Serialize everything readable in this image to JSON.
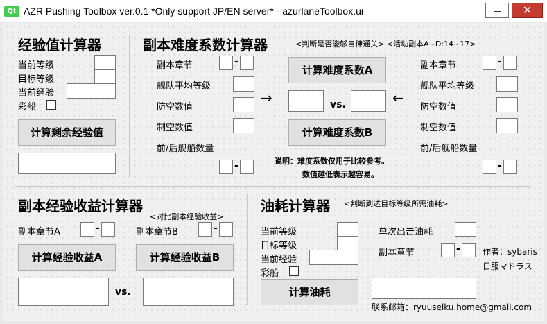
{
  "window": {
    "title": "AZR Pushing Toolbox ver.0.1 *Only support JP/EN server*  - azurlaneToolbox.ui",
    "logo": "Qt",
    "close_symbol": "✕"
  },
  "exp_calc": {
    "title": "经验值计算器",
    "current_level": "当前等级",
    "target_level": "目标等级",
    "current_exp": "当前经验",
    "rainbow": "彩船",
    "button": "计算剩余经验值"
  },
  "difficulty": {
    "title": "副本难度系数计算器",
    "note": "<判断是否能够自律通关> <活动副本A~D:14~17>",
    "left": {
      "chapter": "副本章节",
      "avg_level": "舰队平均等级",
      "aa": "防空数值",
      "air": "制空数值",
      "ships": "前/后舰船数量"
    },
    "right": {
      "chapter": "副本章节",
      "avg_level": "舰队平均等级",
      "aa": "防空数值",
      "air": "制空数值",
      "ships": "前/后舰船数量"
    },
    "button_a": "计算难度系数A",
    "button_b": "计算难度系数B",
    "vs": "vs.",
    "arrow_right": "→",
    "arrow_left": "←",
    "explain_1": "说明：难度系数仅用于比较参考。",
    "explain_2": "数值越低表示越容易。",
    "dash": "-"
  },
  "yield": {
    "title": "副本经验收益计算器",
    "note": "<对比副本经验收益>",
    "chapter_a": "副本章节A",
    "chapter_b": "副本章节B",
    "button_a": "计算经验收益A",
    "button_b": "计算经验收益B",
    "vs": "vs.",
    "dash": "-"
  },
  "oil": {
    "title": "油耗计算器",
    "note": "<判断到达目标等级所需油耗>",
    "current_level": "当前等级",
    "target_level": "目标等级",
    "current_exp": "当前经验",
    "rainbow": "彩船",
    "single_cost": "单次出击油耗",
    "chapter": "副本章节",
    "button": "计算油耗",
    "dash": "-"
  },
  "credits": {
    "author": "作者：sybaris",
    "server": "日服マドラス",
    "email": "联系邮箱：ryuuseiku.home@gmail.com"
  }
}
